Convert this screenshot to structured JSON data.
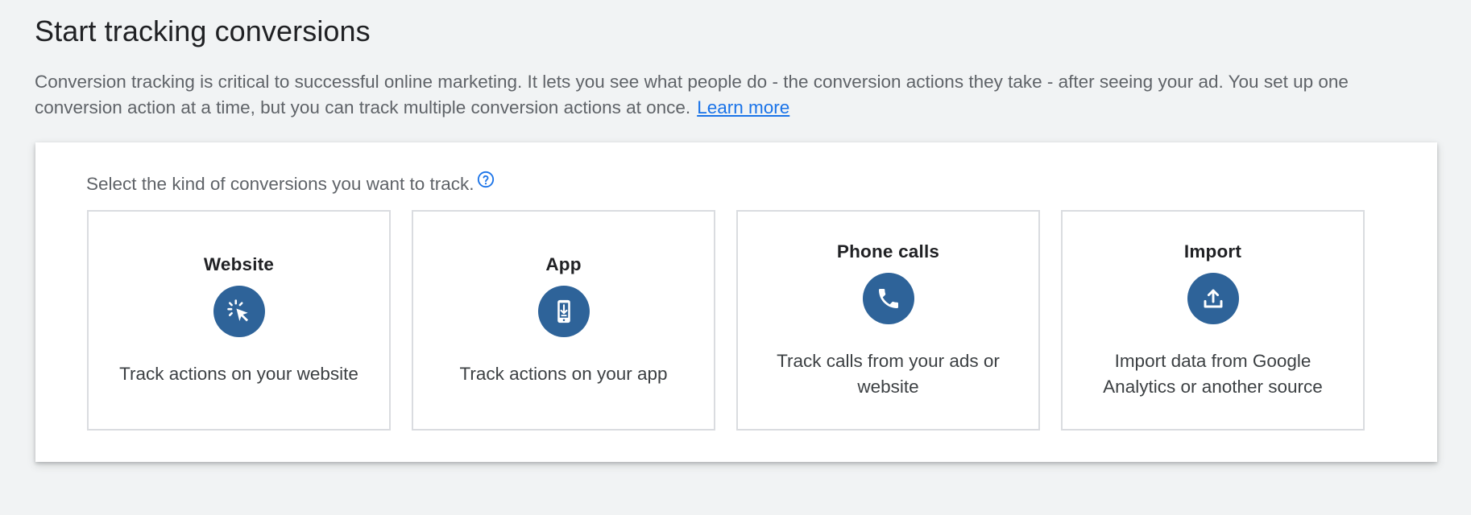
{
  "page": {
    "title": "Start tracking conversions",
    "intro_text": "Conversion tracking is critical to successful online marketing. It lets you see what people do - the conversion actions they take - after seeing your ad. You set up one conversion action at a time, but you can track multiple conversion actions at once.",
    "learn_more_label": "Learn more"
  },
  "panel": {
    "prompt": "Select the kind of conversions you want to track.",
    "help_icon": "help-circle-icon",
    "cards": [
      {
        "title": "Website",
        "icon": "cursor-click-icon",
        "description": "Track actions on your website"
      },
      {
        "title": "App",
        "icon": "mobile-download-icon",
        "description": "Track actions on your app"
      },
      {
        "title": "Phone calls",
        "icon": "phone-icon",
        "description": "Track calls from your ads or website"
      },
      {
        "title": "Import",
        "icon": "upload-icon",
        "description": "Import data from Google Analytics or another source"
      }
    ]
  },
  "colors": {
    "background": "#f1f3f4",
    "icon_circle": "#2e6399",
    "link": "#1a73e8",
    "card_border": "#dadce0"
  }
}
